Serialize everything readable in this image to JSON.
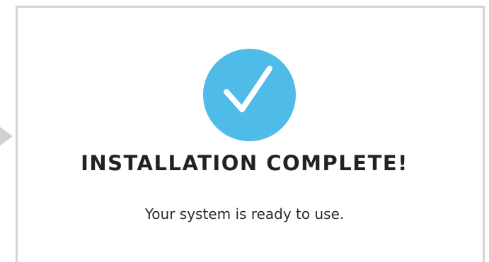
{
  "dialog": {
    "title": "INSTALLATION COMPLETE!",
    "message": "Your system is ready to use.",
    "status_icon": "checkmark-icon"
  },
  "colors": {
    "accent": "#4fbbe9",
    "border": "#d3d3d3",
    "arrow": "#d0d0d0",
    "title_text": "#222222",
    "message_text": "#2b2b2b"
  }
}
